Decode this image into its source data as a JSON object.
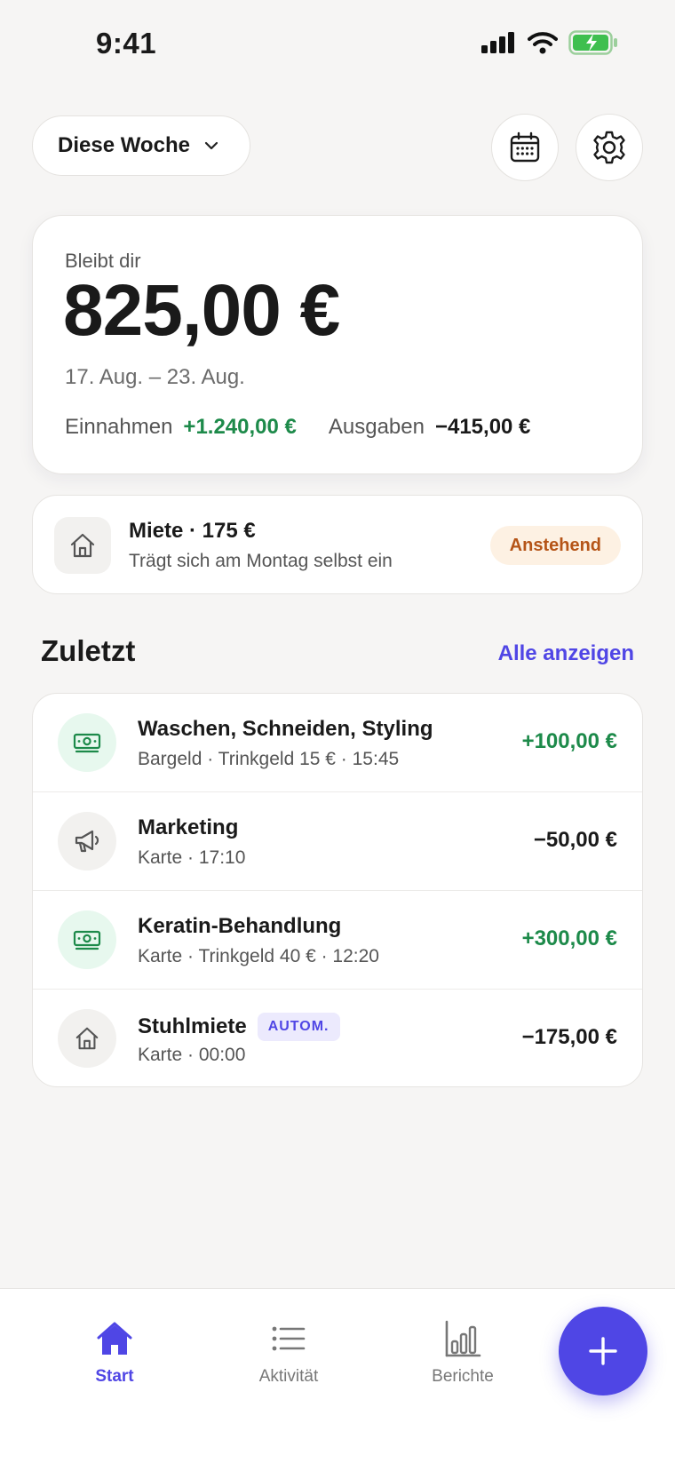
{
  "status_bar": {
    "time": "9:41"
  },
  "header": {
    "period_label": "Diese Woche",
    "calendar_icon": "calendar-icon",
    "settings_icon": "gear-icon"
  },
  "summary": {
    "label": "Bleibt dir",
    "amount": "825,00 €",
    "range": "17. Aug. – 23. Aug.",
    "income_label": "Einnahmen",
    "income_value": "+1.240,00 €",
    "expense_label": "Ausgaben",
    "expense_value": "−415,00 €"
  },
  "pending": {
    "icon": "house-icon",
    "title": "Miete · 175 €",
    "subtitle": "Trägt sich am Montag selbst ein",
    "badge": "Anstehend"
  },
  "recent": {
    "title": "Zuletzt",
    "link": "Alle anzeigen",
    "items": [
      {
        "icon": "cash-icon",
        "title": "Waschen, Schneiden, Styling",
        "subtitle": "Bargeld · Trinkgeld 15 € · 15:45",
        "amount": "+100,00 €",
        "badge": ""
      },
      {
        "icon": "megaphone-icon",
        "title": "Marketing",
        "subtitle": "Karte · 17:10",
        "amount": "−50,00 €",
        "badge": ""
      },
      {
        "icon": "cash-icon",
        "title": "Keratin-Behandlung",
        "subtitle": "Karte · Trinkgeld 40 € · 12:20",
        "amount": "+300,00 €",
        "badge": ""
      },
      {
        "icon": "house-icon",
        "title": "Stuhlmiete",
        "subtitle": "Karte · 00:00",
        "amount": "−175,00 €",
        "badge": "AUTOM."
      }
    ]
  },
  "tabs": {
    "start": "Start",
    "activity": "Aktivität",
    "reports": "Berichte",
    "add_icon": "plus-icon"
  },
  "colors": {
    "accent": "#4f46e5",
    "income": "#1d8a4a",
    "pending_badge_text": "#b55417",
    "pending_badge_bg": "#fdf1e3",
    "background": "#f6f5f4"
  }
}
